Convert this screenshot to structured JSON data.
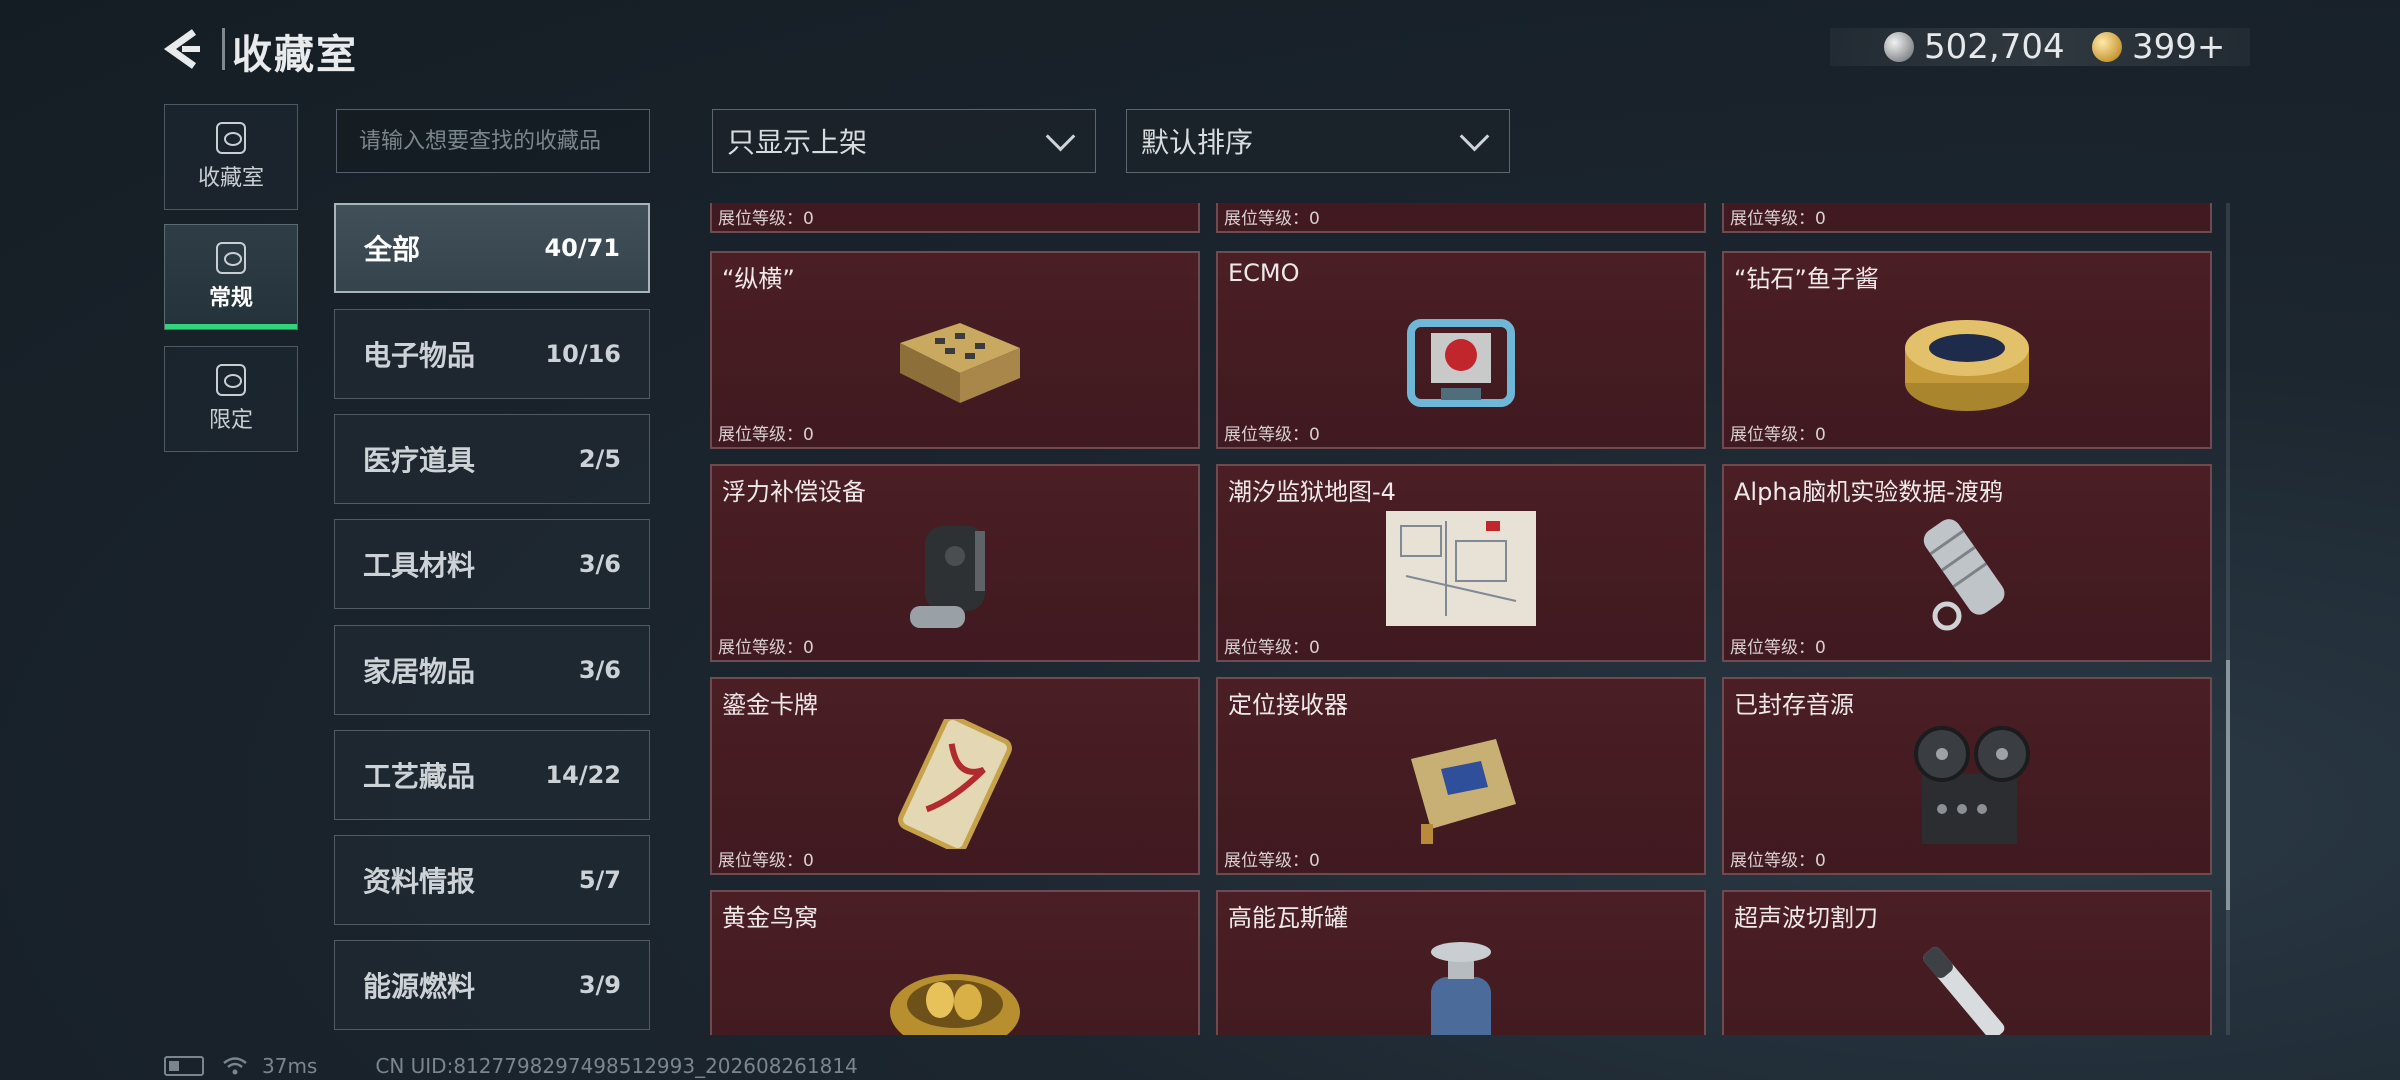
{
  "header": {
    "title": "收藏室",
    "currency": [
      {
        "icon": "silver-coin-icon",
        "value": "502,704"
      },
      {
        "icon": "gold-coin-icon",
        "value": "399+"
      }
    ]
  },
  "side_tabs": [
    {
      "label": "收藏室",
      "icon": "collection-room-icon",
      "active": false
    },
    {
      "label": "常规",
      "icon": "regular-icon",
      "active": true
    },
    {
      "label": "限定",
      "icon": "limited-icon",
      "active": false
    }
  ],
  "search": {
    "placeholder": "请输入想要查找的收藏品"
  },
  "categories": [
    {
      "name": "全部",
      "count": "40/71",
      "active": true
    },
    {
      "name": "电子物品",
      "count": "10/16"
    },
    {
      "name": "医疗道具",
      "count": "2/5"
    },
    {
      "name": "工具材料",
      "count": "3/6"
    },
    {
      "name": "家居物品",
      "count": "3/6"
    },
    {
      "name": "工艺藏品",
      "count": "14/22"
    },
    {
      "name": "资料情报",
      "count": "5/7"
    },
    {
      "name": "能源燃料",
      "count": "3/9"
    }
  ],
  "filters": {
    "shelf": "只显示上架",
    "sort": "默认排序"
  },
  "level_label": "展位等级：0",
  "items": [
    {
      "name": "",
      "icon": "partial-item-icon"
    },
    {
      "name": "",
      "icon": "partial-item-icon"
    },
    {
      "name": "",
      "icon": "partial-item-icon"
    },
    {
      "name": "“纵横”",
      "icon": "chess-box-icon"
    },
    {
      "name": "ECMO",
      "icon": "ecmo-machine-icon"
    },
    {
      "name": "“钻石”鱼子酱",
      "icon": "caviar-tin-icon"
    },
    {
      "name": "浮力补偿设备",
      "icon": "buoyancy-device-icon"
    },
    {
      "name": "潮汐监狱地图-4",
      "icon": "map-icon"
    },
    {
      "name": "Alpha脑机实验数据-渡鸦",
      "icon": "data-canister-icon"
    },
    {
      "name": "鎏金卡牌",
      "icon": "gilded-card-icon"
    },
    {
      "name": "定位接收器",
      "icon": "receiver-icon"
    },
    {
      "name": "已封存音源",
      "icon": "reel-recorder-icon"
    },
    {
      "name": "黄金鸟窝",
      "icon": "golden-nest-icon"
    },
    {
      "name": "高能瓦斯罐",
      "icon": "gas-canister-icon"
    },
    {
      "name": "超声波切割刀",
      "icon": "ultrasonic-knife-icon"
    }
  ],
  "footer": {
    "ping": "37ms",
    "uid": "CN UID:8127798297498512993_202608261814"
  }
}
